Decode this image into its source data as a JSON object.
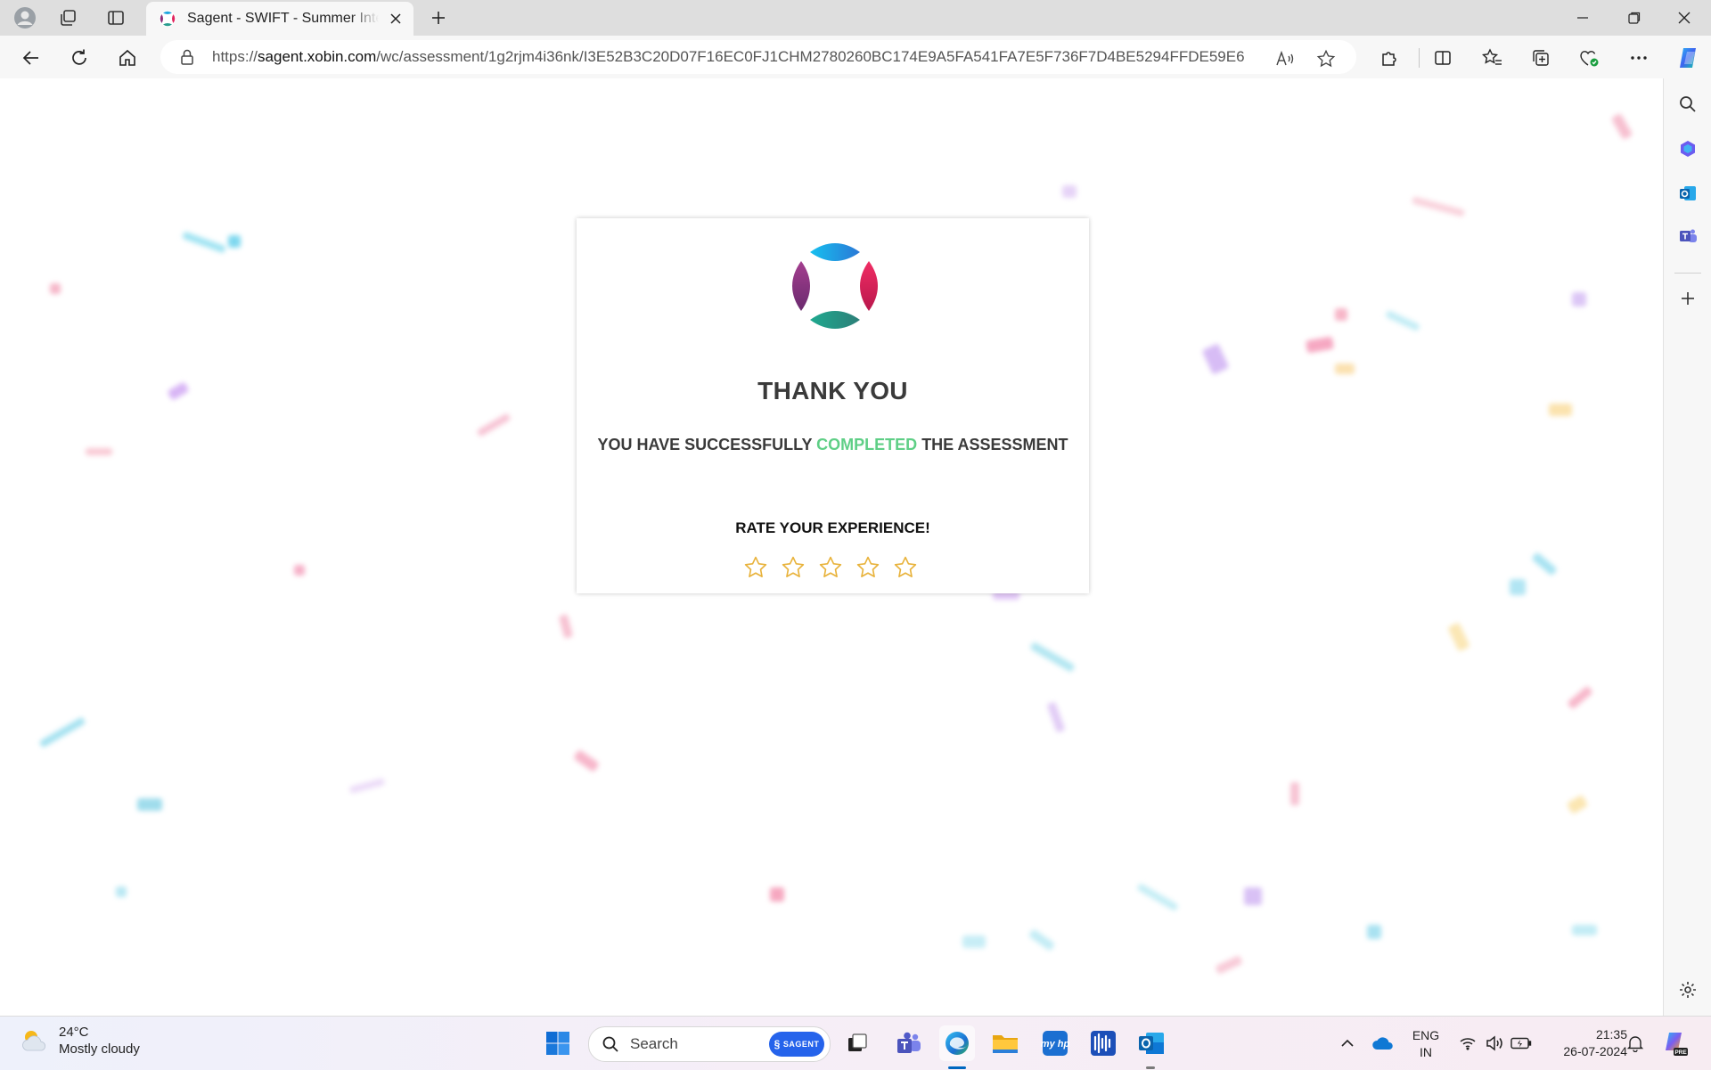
{
  "browser": {
    "tab": {
      "title": "Sagent - SWIFT - Summer Internship",
      "icon": "sagent-logo-icon"
    },
    "url": {
      "prefix": "https://",
      "host": "sagent.xobin.com",
      "path": "/wc/assessment/1g2rjm4i36nk/I3E52B3C20D07F16EC0FJ1CHM2780260BC174E9A5FA541FA7E5F736F7D4BE5294FFDE59E6"
    }
  },
  "page": {
    "heading": "THANK YOU",
    "message_before": "YOU HAVE SUCCESSFULLY ",
    "message_highlight": "COMPLETED",
    "message_after": " THE ASSESSMENT",
    "rate_label": "RATE YOUR EXPERIENCE!",
    "rating": {
      "max": 5,
      "value": 0
    },
    "highlight_color": "#5fcf86",
    "star_color": "#e8b23a"
  },
  "taskbar": {
    "weather": {
      "temp": "24°C",
      "condition": "Mostly cloudy"
    },
    "search_label": "Search",
    "search_badge": "SAGENT",
    "language": {
      "line1": "ENG",
      "line2": "IN"
    },
    "clock": {
      "time": "21:35",
      "date": "26-07-2024"
    }
  }
}
